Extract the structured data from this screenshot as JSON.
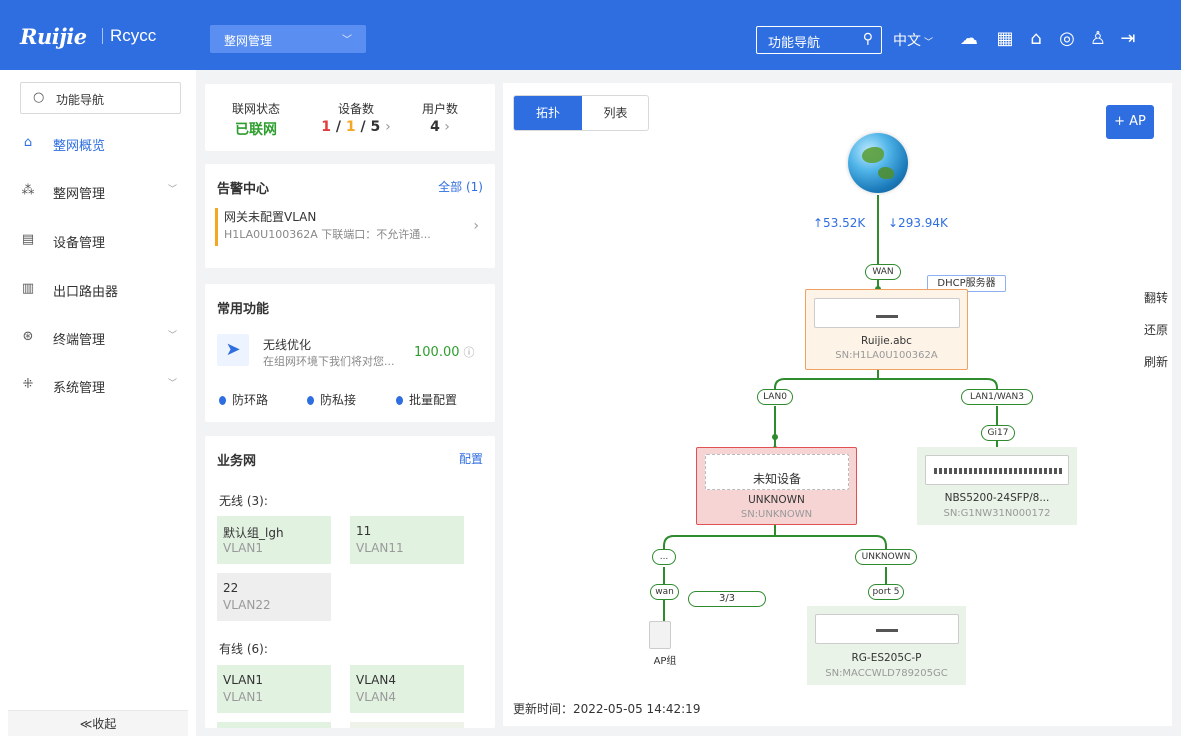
{
  "header": {
    "logo": "Ruijie",
    "logo_sub": "Rcycc",
    "network_select": "整网管理",
    "search_label": "功能导航",
    "language": "中文",
    "colors": {
      "primary": "#2f6ee0"
    }
  },
  "sidebar": {
    "search": "功能导航",
    "items": [
      {
        "label": "整网概览",
        "icon": "home-icon"
      },
      {
        "label": "整网管理",
        "icon": "network-icon"
      },
      {
        "label": "设备管理",
        "icon": "device-icon"
      },
      {
        "label": "出口路由器",
        "icon": "router-icon"
      },
      {
        "label": "终端管理",
        "icon": "terminal-icon"
      },
      {
        "label": "系统管理",
        "icon": "system-icon"
      }
    ],
    "collapse": "≪收起"
  },
  "status": {
    "net_title": "联网状态",
    "net_value": "已联网",
    "dev_title": "设备数",
    "dev_a": "1",
    "dev_b": "1",
    "dev_c": "5",
    "user_title": "用户数",
    "user_value": "4"
  },
  "alarm": {
    "title": "告警中心",
    "all": "全部 (1)",
    "line1": "网关未配置VLAN",
    "line2": "H1LA0U100362A 下联端口：不允许通..."
  },
  "common": {
    "title": "常用功能",
    "func_name": "无线优化",
    "func_desc": "在组网环境下我们将对您...",
    "score": "100.00",
    "tags": [
      "防环路",
      "防私接",
      "批量配置"
    ]
  },
  "business": {
    "title": "业务网",
    "config": "配置",
    "wireless_label": "无线 (3):",
    "wireless": [
      {
        "name": "默认组_lgh",
        "vlan": "VLAN1"
      },
      {
        "name": "11",
        "vlan": "VLAN11"
      },
      {
        "name": "22",
        "vlan": "VLAN22"
      }
    ],
    "wired_label": "有线 (6):",
    "wired": [
      {
        "name": "VLAN1",
        "vlan": "VLAN1"
      },
      {
        "name": "VLAN4",
        "vlan": "VLAN4"
      }
    ]
  },
  "topology": {
    "tab_topo": "拓扑",
    "tab_list": "列表",
    "add_ap": "+ AP",
    "actions": [
      "翻转",
      "还原",
      "刷新"
    ],
    "upload": "↑53.52K",
    "download": "↓293.94K",
    "wan": "WAN",
    "dhcp": "DHCP服务器",
    "gateway": {
      "name": "Ruijie.abc",
      "sn": "SN:H1LA0U100362A"
    },
    "lan0": "LAN0",
    "lan1": "LAN1/WAN3",
    "gi17": "Gi17",
    "unknown_dev": {
      "label": "未知设备",
      "name": "UNKNOWN",
      "sn": "SN:UNKNOWN"
    },
    "switch1": {
      "name": "NBS5200-24SFP/8...",
      "sn": "SN:G1NW31N000172"
    },
    "port_dots": "...",
    "port_unknown": "UNKNOWN",
    "wan_small": "wan",
    "ap_count": "3/3",
    "port5": "port 5",
    "ap_group": "AP组",
    "switch2": {
      "name": "RG-ES205C-P",
      "sn": "SN:MACCWLD789205GC"
    },
    "update_time": "更新时间：2022-05-05 14:42:19"
  }
}
